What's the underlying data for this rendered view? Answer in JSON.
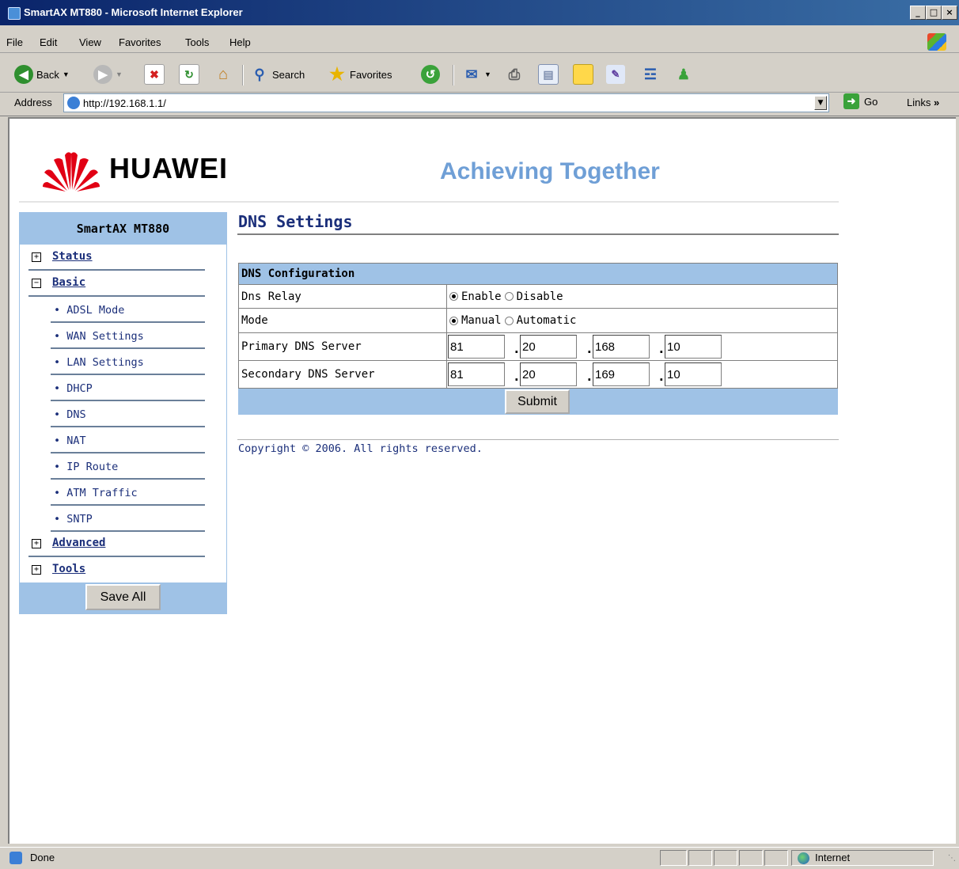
{
  "window": {
    "title": "SmartAX MT880 - Microsoft Internet Explorer",
    "minimize": "_",
    "maximize": "□",
    "close": "×"
  },
  "menu": [
    "File",
    "Edit",
    "View",
    "Favorites",
    "Tools",
    "Help"
  ],
  "toolbar": {
    "back": "Back",
    "search": "Search",
    "favorites": "Favorites"
  },
  "address": {
    "label": "Address",
    "url": "http://192.168.1.1/",
    "go": "Go",
    "links": "Links",
    "links_chevron": "»"
  },
  "header": {
    "brand": "HUAWEI",
    "tagline": "Achieving Together"
  },
  "sidebar": {
    "title": "SmartAX MT880",
    "items": [
      {
        "label": "Status",
        "toggle": "+"
      },
      {
        "label": "Basic",
        "toggle": "−"
      },
      {
        "label": "Advanced",
        "toggle": "+"
      },
      {
        "label": "Tools",
        "toggle": "+"
      }
    ],
    "sub_items": [
      "• ADSL Mode",
      "• WAN Settings",
      "• LAN Settings",
      "• DHCP",
      "• DNS",
      "• NAT",
      "• IP Route",
      "• ATM Traffic",
      "• SNTP"
    ],
    "save_all": "Save All"
  },
  "main": {
    "page_title": "DNS Settings",
    "table_header": "DNS Configuration",
    "rows": {
      "dns_relay": {
        "label": "Dns Relay",
        "opt1": "Enable",
        "opt2": "Disable",
        "selected": "Enable"
      },
      "mode": {
        "label": "Mode",
        "opt1": "Manual",
        "opt2": "Automatic",
        "selected": "Manual"
      },
      "primary": {
        "label": "Primary DNS Server",
        "octets": [
          "81",
          "20",
          "168",
          "10"
        ]
      },
      "secondary": {
        "label": "Secondary DNS Server",
        "octets": [
          "81",
          "20",
          "169",
          "10"
        ]
      }
    },
    "submit": "Submit",
    "copyright": "Copyright © 2006. All rights reserved."
  },
  "status": {
    "text": "Done",
    "zone": "Internet"
  },
  "colors": {
    "accent": "#9fc2e6",
    "title_text": "#1b2f7a",
    "tagline": "#6f9fd6",
    "huawei_red": "#e10014"
  }
}
